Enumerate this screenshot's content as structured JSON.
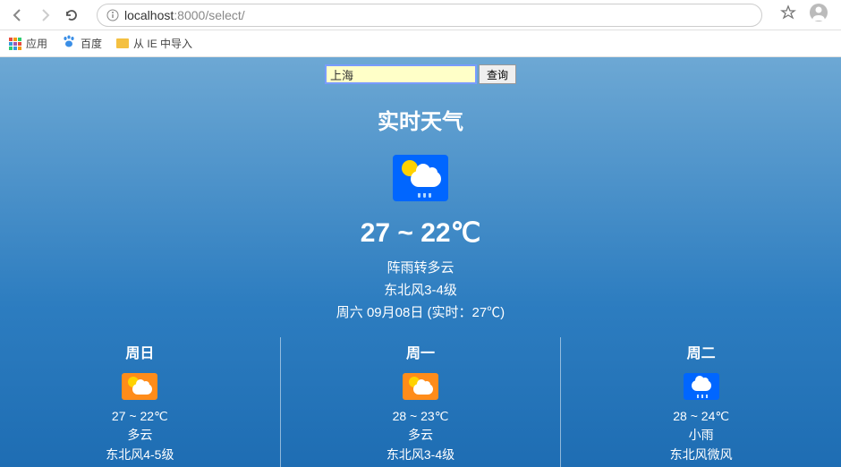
{
  "browser": {
    "url_host": "localhost",
    "url_port": ":8000",
    "url_path": "/select/"
  },
  "bookmarks": {
    "apps": "应用",
    "baidu": "百度",
    "import": "从 IE 中导入"
  },
  "search": {
    "city_value": "上海",
    "query_label": "查询"
  },
  "realtime": {
    "title": "实时天气",
    "temperature": "27 ~ 22℃",
    "condition": "阵雨转多云",
    "wind": "东北风3-4级",
    "date_info": "周六 09月08日 (实时：27℃)"
  },
  "forecast": [
    {
      "day": "周日",
      "icon": "partly-cloudy",
      "temp": "27 ~ 22℃",
      "cond": "多云",
      "wind": "东北风4-5级"
    },
    {
      "day": "周一",
      "icon": "partly-cloudy",
      "temp": "28 ~ 23℃",
      "cond": "多云",
      "wind": "东北风3-4级"
    },
    {
      "day": "周二",
      "icon": "light-rain",
      "temp": "28 ~ 24℃",
      "cond": "小雨",
      "wind": "东北风微风"
    }
  ]
}
